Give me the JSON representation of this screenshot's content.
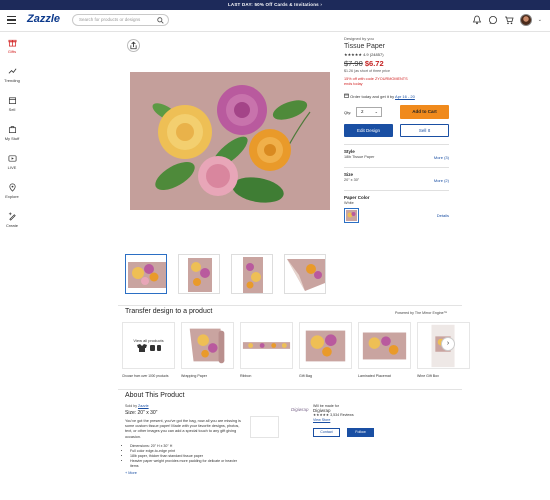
{
  "promo_bar": {
    "text_pre": "LAST DAY:",
    "text_bold": "50% Off Cards & Invitations",
    "arrow": "›"
  },
  "header": {
    "logo": "Zazzle",
    "search_placeholder": "Search for products or designs",
    "icons": [
      "bell-icon",
      "chat-icon",
      "cart-icon"
    ],
    "account_chevron": "⌄"
  },
  "sidenav": {
    "items": [
      {
        "label": "Gifts",
        "icon": "gift-icon"
      },
      {
        "label": "Trending",
        "icon": "trending-icon"
      },
      {
        "label": "Sell",
        "icon": "sell-icon"
      },
      {
        "label": "My Stuff",
        "icon": "my-stuff-icon"
      },
      {
        "label": "LIVE",
        "icon": "live-icon"
      },
      {
        "label": "Explore",
        "icon": "explore-icon"
      },
      {
        "label": "Create",
        "icon": "create-icon"
      }
    ]
  },
  "product": {
    "designed_by": "Designed by you",
    "title": "Tissue Paper",
    "rating_stars": "★★★★★",
    "rating_text": "4.9 (24857)",
    "price_old": "$7.90",
    "price_new": "$6.72",
    "save_text": "$1.26 (as short of three price",
    "promo_line1": "15% off with code ZYOURMOMENTS",
    "promo_line2": "ends today",
    "order_text": "Order today and get it by",
    "order_date": "Apr 16 - 20",
    "qty_label": "Qty:",
    "qty_value": "2",
    "add_to_cart": "Add to Cart",
    "edit_design": "Edit Design",
    "sell_it": "Sell It",
    "options": [
      {
        "label": "Style",
        "value": "18lb Tissue Paper",
        "more": "More (3)"
      },
      {
        "label": "Size",
        "value": "20\" x 30\"",
        "more": "More (2)"
      },
      {
        "label": "Paper Color",
        "value": "White",
        "more": "Details"
      }
    ]
  },
  "transfer": {
    "title": "Transfer design to a product",
    "powered_by": "Powered by The Mirror Engine™",
    "view_all": "View all products",
    "view_all_caption": "Choose from over 1000 products",
    "items": [
      "Wrapping Paper",
      "Ribbon",
      "Gift Bag",
      "Laminated Placemat",
      "Wine Gift Box"
    ],
    "next": "›"
  },
  "about": {
    "title": "About This Product",
    "sold_by_label": "Sold by",
    "sold_by": "Zazzle",
    "size": "Size: 20\" x 30\"",
    "description": "You've got the present, you've got the bag, now all you are missing is some custom tissue paper! Made with your favorite designs, photos, text, or other images you can add a special touch to any gift giving occasion.",
    "bullets": [
      "Dimensions: 20\" H x 30\" H",
      "Full color edge-to-edge print",
      "18lb paper, thicker than standard tissue paper",
      "Heavier paper weight provides more padding for delicate or heavier items"
    ],
    "more": "+ More"
  },
  "designer": {
    "brand": "Digiwrap",
    "will_be_made_for": "Will be made for",
    "name": "Digiwrap",
    "rating": "★★★★★",
    "reviews": "3,534 Reviews",
    "view_store": "View Store",
    "contact": "Contact",
    "follow": "Follow"
  }
}
